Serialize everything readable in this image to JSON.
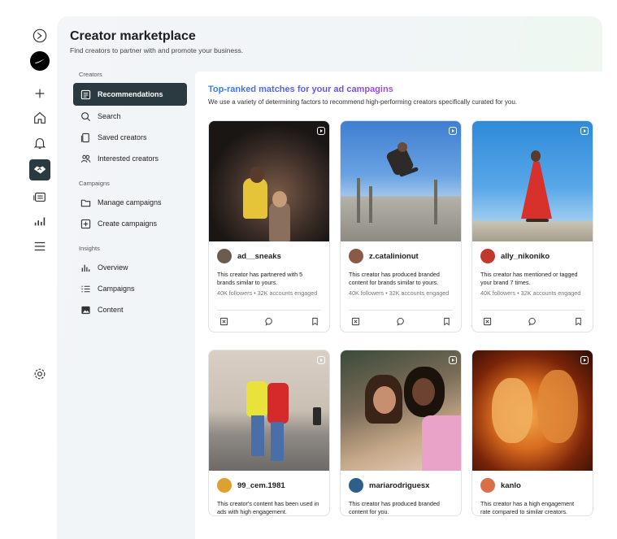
{
  "page": {
    "title": "Creator marketplace",
    "subtitle": "Find creators to partner with and promote your business."
  },
  "rail": {
    "icons": [
      "meta-logo-icon",
      "nike-avatar-icon",
      "plus-icon",
      "home-icon",
      "bell-icon",
      "handshake-icon",
      "ads-icon",
      "insights-icon",
      "menu-icon",
      "settings-icon"
    ]
  },
  "sidebar": {
    "creators_label": "Creators",
    "creators_items": [
      {
        "label": "Recommendations",
        "icon": "recommendations-icon",
        "active": true
      },
      {
        "label": "Search",
        "icon": "search-icon"
      },
      {
        "label": "Saved creators",
        "icon": "saved-icon"
      },
      {
        "label": "Interested creators",
        "icon": "interested-icon"
      }
    ],
    "campaigns_label": "Campaigns",
    "campaigns_items": [
      {
        "label": "Manage campaigns",
        "icon": "folder-icon"
      },
      {
        "label": "Create campaigns",
        "icon": "add-box-icon"
      }
    ],
    "insights_label": "Insights",
    "insights_items": [
      {
        "label": "Overview",
        "icon": "bar-chart-icon"
      },
      {
        "label": "Campaigns",
        "icon": "list-icon"
      },
      {
        "label": "Content",
        "icon": "image-icon"
      }
    ]
  },
  "main": {
    "heading": "Top-ranked matches for your ad campagins",
    "description": "We use a variety of determining factors to recommend high-performing creators specifically curated for you."
  },
  "cards": [
    {
      "handle": "ad__sneaks",
      "desc": "This creator has partnered with 5 brands similar to yours.",
      "stats": "40K followers • 32K accounts engaged"
    },
    {
      "handle": "z.catalinionut",
      "desc": "This creator has produced branded content for brands similar to yours.",
      "stats": "40K followers • 32K accounts engaged"
    },
    {
      "handle": "ally_nikoniko",
      "desc": "This creator has mentioned or tagged your brand 7 times.",
      "stats": "40K followers • 32K accounts engaged"
    },
    {
      "handle": "99_cem.1981",
      "desc": "This creator's content has been used in ads with high engagement.",
      "stats": ""
    },
    {
      "handle": "mariarodriguesx",
      "desc": "This creator has produced branded content for you.",
      "stats": ""
    },
    {
      "handle": "kanlo",
      "desc": "This creator has a high engagement rate compared to similar creators.",
      "stats": ""
    }
  ],
  "colors": {
    "accent_dark": "#2b3940",
    "heading_gradient_start": "#2f80ed",
    "heading_gradient_end": "#a34ee0"
  }
}
